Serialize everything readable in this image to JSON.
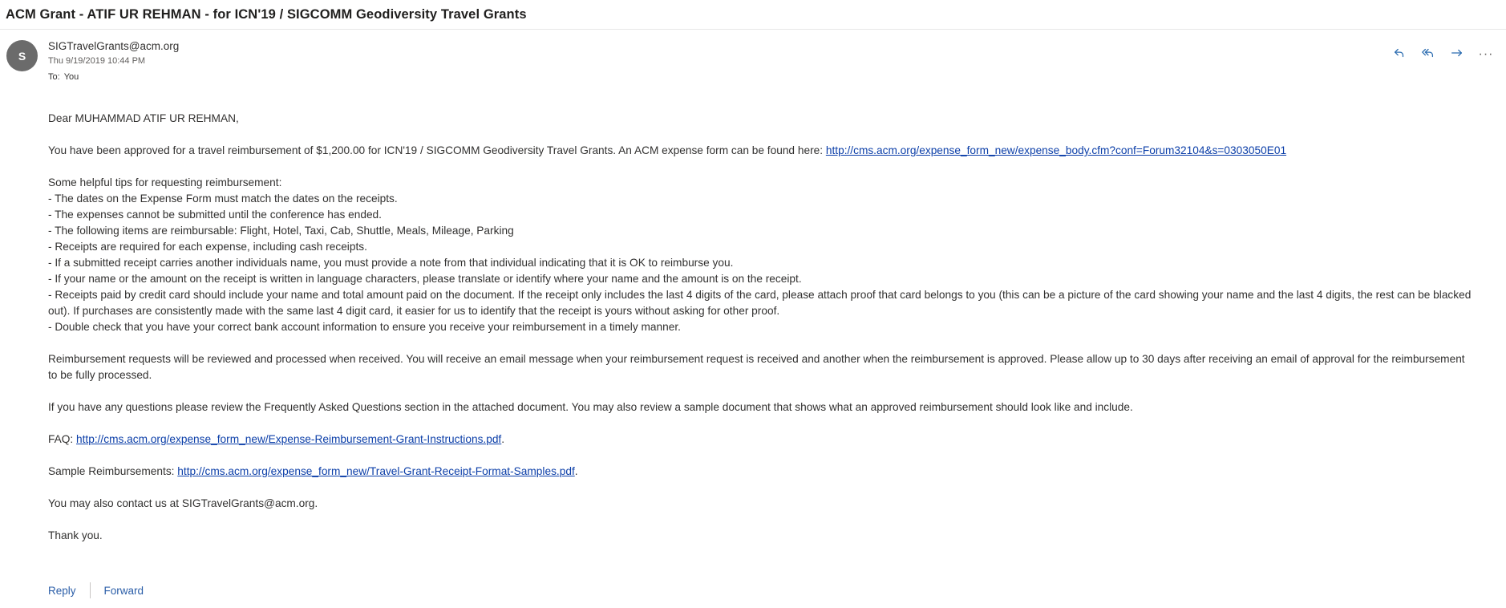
{
  "subject": "ACM Grant - ATIF UR REHMAN - for ICN'19 / SIGCOMM Geodiversity Travel Grants",
  "sender": {
    "initial": "S",
    "email": "SIGTravelGrants@acm.org",
    "date": "Thu 9/19/2019 10:44 PM",
    "to_label": "To:",
    "to_value": "You"
  },
  "actions": {
    "reply_icon": "reply-icon",
    "reply_all_icon": "reply-all-icon",
    "forward_icon": "forward-icon",
    "more_label": "···"
  },
  "body": {
    "greeting": "Dear MUHAMMAD ATIF UR REHMAN,",
    "approval_text": "You have been approved for a travel reimbursement of $1,200.00 for ICN'19 / SIGCOMM Geodiversity Travel Grants. An ACM expense form can be found here: ",
    "approval_link": "http://cms.acm.org/expense_form_new/expense_body.cfm?conf=Forum32104&s=0303050E01",
    "tips_heading": "Some helpful tips for requesting reimbursement:",
    "tips": [
      "- The dates on the Expense Form must match the dates on the receipts.",
      "- The expenses cannot be submitted until the conference has ended.",
      "- The following items are reimbursable: Flight, Hotel, Taxi, Cab, Shuttle, Meals, Mileage, Parking",
      "- Receipts are required for each expense, including cash receipts.",
      "- If a submitted receipt carries another individuals name, you must provide a note from that individual indicating that it is OK to reimburse you.",
      "- If your name or the amount on the receipt is written in language characters, please translate or identify where your name and the amount is on the receipt.",
      "- Receipts paid by credit card should include your name and total amount paid on the document. If the receipt only includes the last 4 digits of the card, please attach proof that card belongs to you (this can be a picture of the card showing your name and the last 4 digits, the rest can be blacked out). If purchases are consistently made with the same last 4 digit card, it easier for us to identify that the receipt is yours without asking for other proof.",
      "- Double check that you have your correct bank account information to ensure you receive your reimbursement in a timely manner."
    ],
    "review_text": "Reimbursement requests will be reviewed and processed when received. You will receive an email message when your reimbursement request is received and another when the reimbursement is approved. Please allow up to 30 days after receiving an email of approval for the reimbursement to be fully processed.",
    "questions_text": "If you have any questions please review the Frequently Asked Questions section in the attached document. You may also review a sample document that shows what an approved reimbursement should look like and include.",
    "faq_label": "FAQ: ",
    "faq_link": "http://cms.acm.org/expense_form_new/Expense-Reimbursement-Grant-Instructions.pdf",
    "faq_suffix": ".",
    "samples_label": "Sample Reimbursements: ",
    "samples_link": "http://cms.acm.org/expense_form_new/Travel-Grant-Receipt-Format-Samples.pdf",
    "samples_suffix": ".",
    "contact_text": "You may also contact us at SIGTravelGrants@acm.org.",
    "closing": "Thank you."
  },
  "footer": {
    "reply_label": "Reply",
    "forward_label": "Forward"
  }
}
